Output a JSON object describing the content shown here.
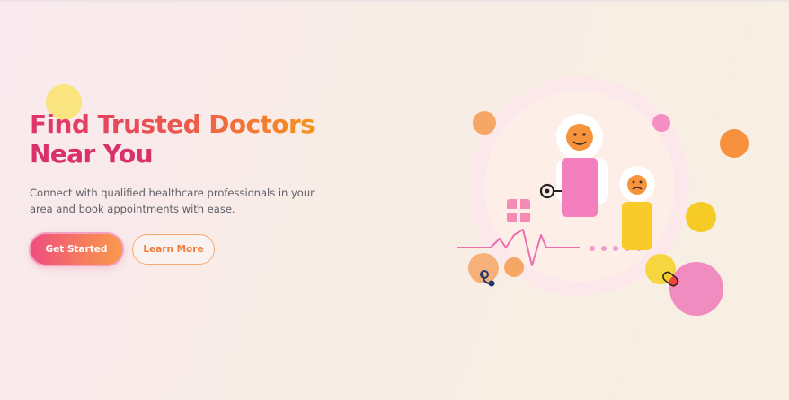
{
  "hero": {
    "headline_part1": "Find Trusted Doctors",
    "headline_part2": "Near You",
    "subtext": "Connect with qualified healthcare professionals in your area and book appointments with ease.",
    "primary_button": "Get Started",
    "secondary_button": "Learn More"
  },
  "colors": {
    "brand_pink": "#e0336e",
    "brand_orange": "#f7941d",
    "background": "#f8ece6",
    "body_text": "#5d5d66",
    "accent_yellow": "#f7e37a"
  },
  "illustration": {
    "icons": [
      "doctor-avatar-icon",
      "sad-patient-icon",
      "stethoscope-icon",
      "medical-cross-icon",
      "heartbeat-line-icon",
      "pill-icon"
    ]
  }
}
